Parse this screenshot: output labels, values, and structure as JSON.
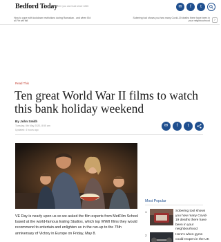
{
  "header": {
    "masthead": "Bedford Today",
    "tagline": "Where you can trust since 1845",
    "icons": [
      "email-icon",
      "facebook-icon",
      "twitter-icon",
      "search-icon"
    ]
  },
  "ticker": {
    "left": "How to cope with lockdown restrictions during Ramadan - and when Eid al-Fitr will fall",
    "right": "Sobering tool shows you how many Covid-19 deaths there have been in your neighbourhood"
  },
  "article": {
    "section": "Read This",
    "headline": "Ten great World War II films to watch this bank holiday weekend",
    "byline": "By John Smith",
    "date": "Tuesday, 5th May 2020, 8:55 am",
    "updated": "Updated: 4 hours ago",
    "share_icons": [
      "email-icon",
      "facebook-icon",
      "twitter-icon",
      "share-icon"
    ],
    "body": "VE Day is nearly upon us so we asked the film experts from MetFilm School based at the world-famous Ealing Studios, which top WWII films they would recommend to entertain and enlighten us in the run-up to the 75th anniversary of Victory in Europe on Friday, May 8."
  },
  "most_popular": {
    "title": "Most Popular",
    "items": [
      {
        "num": "1",
        "text": "Sobering tool shows you how many Covid-19 deaths there have been in your neighbourhood"
      },
      {
        "num": "2",
        "text": "Here's when gyms could reopen in the UK"
      }
    ]
  }
}
